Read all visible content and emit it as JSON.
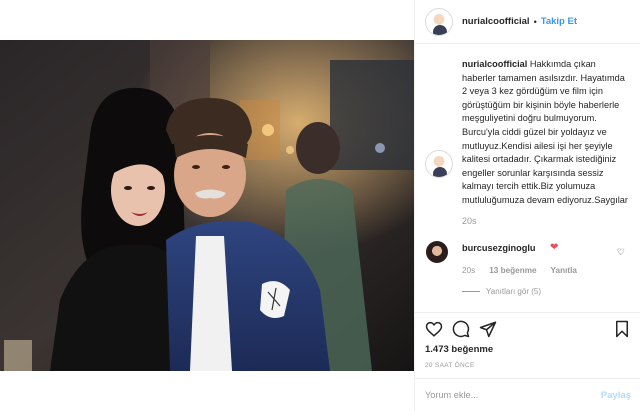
{
  "post": {
    "username": "nurialcoofficial",
    "separator": "•",
    "follow_label": "Takip Et"
  },
  "caption": {
    "username": "nurialcoofficial",
    "text": "Hakkımda çıkan haberler tamamen asılsızdır. Hayatımda 2 veya 3 kez gördüğüm ve film için görüştüğüm bir kişinin böyle haberlerle meşguliyetini doğru bulmuyorum. Burcu'yla ciddi güzel bir yoldayız ve mutluyuz.Kendisi ailesi işi her şeyiyle kalitesi ortadadır. Çıkarmak istediğiniz engeller sorunlar karşısında sessiz kalmayı tercih ettik.Biz yolumuza mutluluğumuza devam ediyoruz.Saygılar",
    "time": "20s"
  },
  "reply": {
    "username": "burcusezginoglu",
    "heart": "❤",
    "time": "20s",
    "likes": "13 beğenme",
    "reply_label": "Yanıtla",
    "view_replies": "Yanıtları gör (5)"
  },
  "actions": {
    "likes_count": "1.473 beğenme",
    "posted_time": "20 SAAT ÖNCE"
  },
  "comment_box": {
    "placeholder": "Yorum ekle...",
    "post_label": "Paylaş"
  }
}
